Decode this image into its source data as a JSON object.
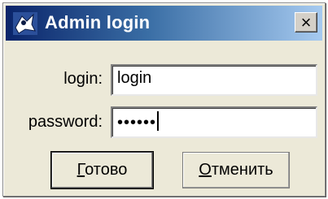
{
  "window": {
    "title": "Admin login",
    "close_glyph": "×",
    "titlebar_colors": [
      "#0a246a",
      "#a6caf0"
    ],
    "icon": "app-icon"
  },
  "form": {
    "login_label": "login:",
    "login_value": "login",
    "password_label": "password:",
    "password_masked": "••••••"
  },
  "buttons": {
    "ok": {
      "accel": "Г",
      "rest": "отово"
    },
    "cancel": {
      "accel": "О",
      "rest": "тменить"
    }
  }
}
